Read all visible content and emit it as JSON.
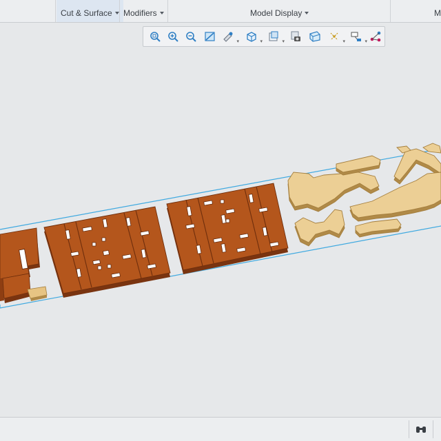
{
  "ribbon": {
    "groups": [
      {
        "label": "Cut & Surface",
        "has_menu": true
      },
      {
        "label": "Modifiers",
        "has_menu": true
      },
      {
        "label": "Model Display",
        "has_menu": true
      },
      {
        "label": "M",
        "has_menu": false
      }
    ]
  },
  "view_toolbar": {
    "buttons": [
      {
        "name": "refit-icon"
      },
      {
        "name": "zoom-in-icon"
      },
      {
        "name": "zoom-out-icon"
      },
      {
        "name": "repaint-icon"
      },
      {
        "name": "reorient-icon"
      },
      {
        "name": "saved-orientations-icon"
      },
      {
        "name": "display-style-icon"
      },
      {
        "name": "view-manager-icon"
      },
      {
        "name": "perspective-view-icon"
      },
      {
        "name": "datum-display-icon"
      },
      {
        "name": "annotation-display-icon"
      },
      {
        "name": "spin-center-icon"
      }
    ]
  },
  "colors": {
    "plywood_dark": "#b4561c",
    "plywood_dark_edge": "#7a3410",
    "plywood_light": "#eccf95",
    "plywood_light_edge": "#b08a48",
    "sheet_outline": "#3fa9e0",
    "background": "#e6e8ea"
  }
}
